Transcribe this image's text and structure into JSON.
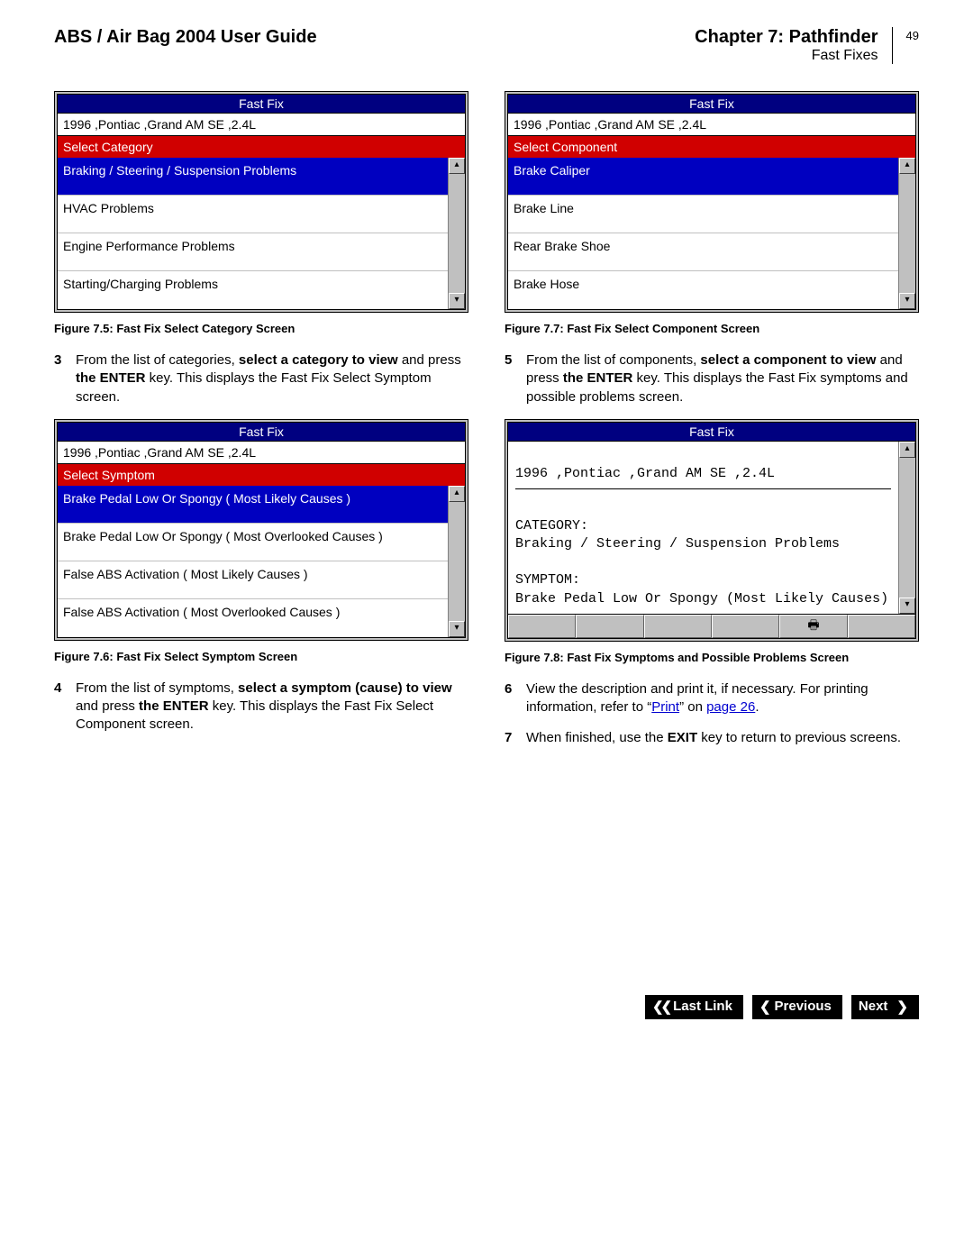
{
  "header": {
    "guide_title": "ABS / Air Bag 2004 User Guide",
    "chapter": "Chapter 7: Pathfinder",
    "section": "Fast Fixes",
    "page_number": "49"
  },
  "fig75": {
    "title": "Fast Fix",
    "vehicle": "1996 ,Pontiac ,Grand AM SE ,2.4L",
    "prompt": "Select Category",
    "items": [
      "Braking / Steering / Suspension Problems",
      "HVAC Problems",
      "Engine Performance Problems",
      "Starting/Charging Problems"
    ],
    "caption": "Figure 7.5: Fast Fix Select Category Screen"
  },
  "step3": {
    "num": "3",
    "text_a": "From the list of categories, ",
    "bold_a": "select a category to view",
    "text_b": " and press ",
    "bold_b": "the ENTER",
    "text_c": " key. This displays the Fast Fix Select Symptom screen."
  },
  "fig76": {
    "title": "Fast Fix",
    "vehicle": "1996 ,Pontiac ,Grand AM SE ,2.4L",
    "prompt": "Select Symptom",
    "items": [
      "Brake Pedal  Low Or Spongy   ( Most Likely Causes )",
      "Brake Pedal  Low Or Spongy   ( Most Overlooked Causes )",
      "False ABS Activation   ( Most Likely Causes )",
      "False ABS Activation   ( Most Overlooked Causes )"
    ],
    "caption": "Figure 7.6: Fast Fix Select Symptom Screen"
  },
  "step4": {
    "num": "4",
    "text_a": "From the list of symptoms, ",
    "bold_a": "select a symptom (cause) to view",
    "text_b": " and press ",
    "bold_b": "the ENTER",
    "text_c": " key. This displays the Fast Fix Select Component screen."
  },
  "fig77": {
    "title": "Fast Fix",
    "vehicle": "1996 ,Pontiac ,Grand AM SE ,2.4L",
    "prompt": "Select Component",
    "items": [
      "Brake Caliper",
      "Brake Line",
      "Rear Brake Shoe",
      "Brake Hose"
    ],
    "caption": "Figure 7.7: Fast Fix Select Component Screen"
  },
  "step5": {
    "num": "5",
    "text_a": "From the list of components, ",
    "bold_a": "select a component to view",
    "text_b": " and press ",
    "bold_b": "the ENTER",
    "text_c": " key. This displays the Fast Fix symptoms and possible problems screen."
  },
  "fig78": {
    "title": "Fast Fix",
    "line1": "1996 ,Pontiac ,Grand AM SE ,2.4L",
    "cat_label": "CATEGORY:",
    "cat_val": "Braking / Steering / Suspension Problems",
    "sym_label": "SYMPTOM:",
    "sym_val": "Brake Pedal  Low Or Spongy (Most Likely Causes)",
    "caption": "Figure 7.8: Fast Fix Symptoms and Possible Problems Screen"
  },
  "step6": {
    "num": "6",
    "text_a": "View the description and print it, if necessary. For printing information, refer to “",
    "link_a": "Print",
    "text_b": "” on ",
    "link_b": "page 26",
    "text_c": "."
  },
  "step7": {
    "num": "7",
    "text_a": "When finished, use the ",
    "bold_a": "EXIT",
    "text_b": " key to return to previous screens."
  },
  "nav": {
    "last_link": "Last Link",
    "previous": "Previous",
    "next": "Next"
  },
  "icons": {
    "print": "🖶"
  }
}
